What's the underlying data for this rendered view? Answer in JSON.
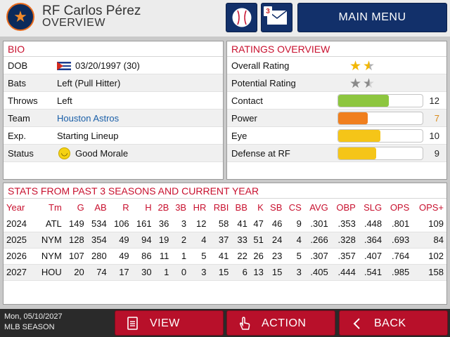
{
  "header": {
    "player_name": "RF Carlos Pérez",
    "screen_title": "OVERVIEW",
    "mail_count": "3",
    "main_menu_label": "MAIN MENU"
  },
  "bio": {
    "title": "BIO",
    "rows": [
      {
        "label": "DOB",
        "value": "03/20/1997 (30)"
      },
      {
        "label": "Bats",
        "value": "Left (Pull Hitter)"
      },
      {
        "label": "Throws",
        "value": "Left"
      },
      {
        "label": "Team",
        "value": "Houston Astros"
      },
      {
        "label": "Exp.",
        "value": "Starting Lineup"
      },
      {
        "label": "Status",
        "value": "Good Morale"
      }
    ]
  },
  "ratings": {
    "title": "RATINGS OVERVIEW",
    "overall_label": "Overall Rating",
    "overall_stars": 1.5,
    "potential_label": "Potential Rating",
    "potential_stars": 1.5,
    "bars": [
      {
        "label": "Contact",
        "value": "12",
        "fraction": 0.6,
        "color": "#8dc63f",
        "num_color": "#222222"
      },
      {
        "label": "Power",
        "value": "7",
        "fraction": 0.35,
        "color": "#f07f1e",
        "num_color": "#d98b1a"
      },
      {
        "label": "Eye",
        "value": "10",
        "fraction": 0.5,
        "color": "#f5c518",
        "num_color": "#222222"
      },
      {
        "label": "Defense at RF",
        "value": "9",
        "fraction": 0.45,
        "color": "#f5c518",
        "num_color": "#222222"
      }
    ]
  },
  "stats": {
    "title": "STATS FROM PAST 3 SEASONS AND CURRENT YEAR",
    "columns": [
      "Year",
      "Tm",
      "G",
      "AB",
      "R",
      "H",
      "2B",
      "3B",
      "HR",
      "RBI",
      "BB",
      "K",
      "SB",
      "CS",
      "AVG",
      "OBP",
      "SLG",
      "OPS",
      "OPS+"
    ],
    "rows": [
      [
        "2024",
        "ATL",
        "149",
        "534",
        "106",
        "161",
        "36",
        "3",
        "12",
        "58",
        "41",
        "47",
        "46",
        "9",
        ".301",
        ".353",
        ".448",
        ".801",
        "109"
      ],
      [
        "2025",
        "NYM",
        "128",
        "354",
        "49",
        "94",
        "19",
        "2",
        "4",
        "37",
        "33",
        "51",
        "24",
        "4",
        ".266",
        ".328",
        ".364",
        ".693",
        "84"
      ],
      [
        "2026",
        "NYM",
        "107",
        "280",
        "49",
        "86",
        "11",
        "1",
        "5",
        "41",
        "22",
        "26",
        "23",
        "5",
        ".307",
        ".357",
        ".407",
        ".764",
        "102"
      ],
      [
        "2027",
        "HOU",
        "20",
        "74",
        "17",
        "30",
        "1",
        "0",
        "3",
        "15",
        "6",
        "13",
        "15",
        "3",
        ".405",
        ".444",
        ".541",
        ".985",
        "158"
      ]
    ]
  },
  "footer": {
    "date": "Mon, 05/10/2027",
    "season": "MLB SEASON",
    "view_label": "VIEW",
    "action_label": "ACTION",
    "back_label": "BACK"
  }
}
